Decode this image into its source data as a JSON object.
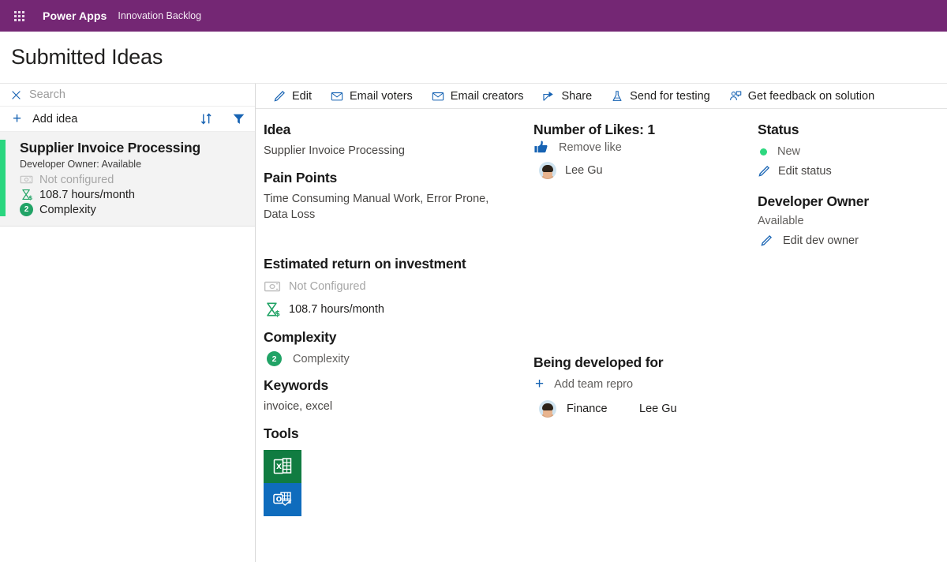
{
  "topbar": {
    "waffle_icon": "app-launcher-icon",
    "brand": "Power Apps",
    "app_name": "Innovation Backlog",
    "background_color": "#742774"
  },
  "page": {
    "title": "Submitted Ideas"
  },
  "left_pane": {
    "search": {
      "icon": "close-icon",
      "placeholder": "Search",
      "value": ""
    },
    "add_idea": {
      "icon": "plus-icon",
      "label": "Add idea"
    },
    "sort_icon": "sort-icon",
    "filter_icon": "filter-icon",
    "items": [
      {
        "title": "Supplier Invoice Processing",
        "subtitle": "Developer Owner: Available",
        "money_icon": "money-icon",
        "money_label": "Not configured",
        "hours_icon": "hourglass-dollar-icon",
        "hours_label": "108.7 hours/month",
        "complexity_badge": "2",
        "complexity_label": "Complexity",
        "accent_color": "#2ad67f",
        "selected": true
      }
    ]
  },
  "command_bar": {
    "commands": [
      {
        "icon": "edit-pencil-icon",
        "label": "Edit"
      },
      {
        "icon": "mail-icon",
        "label": "Email voters"
      },
      {
        "icon": "mail-icon",
        "label": "Email creators"
      },
      {
        "icon": "share-icon",
        "label": "Share"
      },
      {
        "icon": "flask-icon",
        "label": "Send for testing"
      },
      {
        "icon": "feedback-person-icon",
        "label": "Get feedback on solution"
      }
    ]
  },
  "details": {
    "idea": {
      "header": "Idea",
      "value": "Supplier Invoice Processing"
    },
    "pain_points": {
      "header": "Pain Points",
      "value": "Time Consuming Manual Work, Error Prone, Data Loss"
    },
    "roi": {
      "header": "Estimated return on investment",
      "money_icon": "money-icon",
      "money_label": "Not Configured",
      "hours_icon": "hourglass-dollar-icon",
      "hours_label": "108.7 hours/month"
    },
    "complexity": {
      "header": "Complexity",
      "badge": "2",
      "label": "Complexity"
    },
    "keywords": {
      "header": "Keywords",
      "value": "invoice, excel"
    },
    "tools": {
      "header": "Tools",
      "items": [
        {
          "icon": "excel-icon",
          "name": "Excel",
          "color": "#107c41"
        },
        {
          "icon": "outlook-icon",
          "name": "Outlook",
          "color": "#0f6cbd"
        }
      ]
    }
  },
  "likes": {
    "header": "Number of Likes: 1",
    "count": 1,
    "action_icon": "thumbs-up-icon",
    "action_label": "Remove like",
    "voters": [
      {
        "avatar": "avatar-icon",
        "name": "Lee Gu"
      }
    ]
  },
  "developed_for": {
    "header": "Being developed for",
    "add_icon": "plus-icon",
    "add_label": "Add team repro",
    "rows": [
      {
        "avatar": "avatar-icon",
        "team": "Finance",
        "person": "Lee Gu"
      }
    ]
  },
  "status": {
    "header": "Status",
    "dot_color": "#2dd87f",
    "value": "New",
    "edit_icon": "edit-pencil-icon",
    "edit_label": "Edit status"
  },
  "developer_owner": {
    "header": "Developer Owner",
    "value": "Available",
    "edit_icon": "edit-pencil-icon",
    "edit_label": "Edit dev owner"
  }
}
